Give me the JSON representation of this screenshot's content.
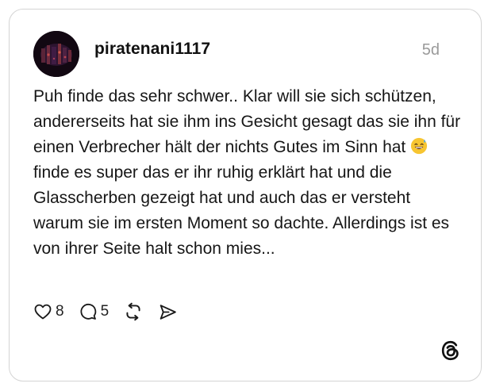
{
  "post": {
    "username": "piratenani1117",
    "timestamp": "5d",
    "text_before_emoji": "Puh finde das sehr schwer.. Klar will sie sich schützen, andererseits hat sie ihm ins Gesicht gesagt das sie ihn für einen Verbrecher hält der nichts Gutes im Sinn hat ",
    "emoji": "grinning-face-with-sweat",
    "text_after_emoji": " finde es super das er ihr ruhig erklärt hat und die Glasscherben gezeigt hat und auch das er versteht warum sie im ersten Moment so dachte. Allerdings ist es von ihrer Seite halt schon mies..."
  },
  "actions": {
    "likes": "8",
    "replies": "5"
  },
  "icons": {
    "like": "heart-icon",
    "reply": "comment-icon",
    "repost": "repost-icon",
    "share": "send-icon",
    "brand": "threads-logo-icon"
  },
  "colors": {
    "card_border": "#d4d4d4",
    "text": "#161616",
    "muted": "#9a9a9a"
  }
}
